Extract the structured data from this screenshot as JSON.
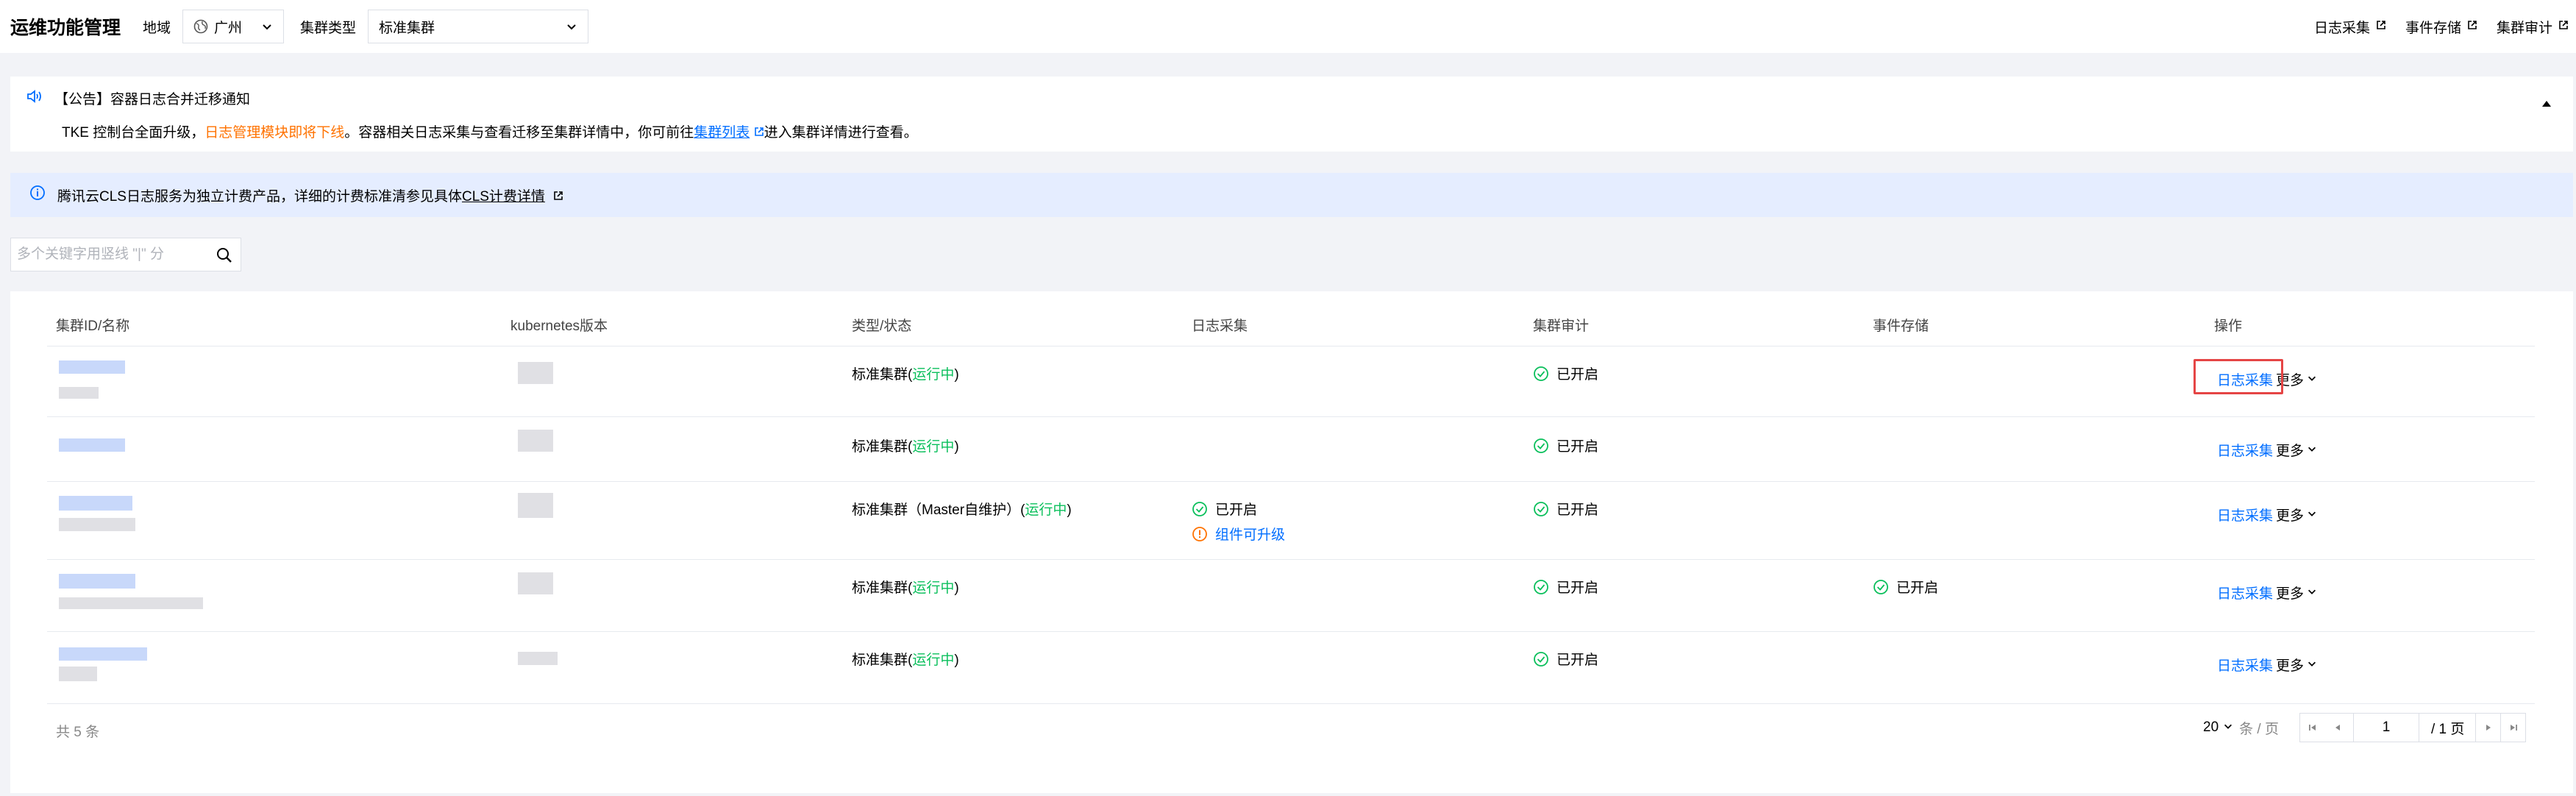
{
  "header": {
    "title": "运维功能管理",
    "region_label": "地域",
    "region_value": "广州",
    "cluster_type_label": "集群类型",
    "cluster_type_value": "标准集群",
    "links": [
      {
        "label": "日志采集",
        "icon": "external-link-icon"
      },
      {
        "label": "事件存储",
        "icon": "external-link-icon"
      },
      {
        "label": "集群审计",
        "icon": "external-link-icon"
      }
    ]
  },
  "notice": {
    "title": "【公告】容器日志合并迁移通知",
    "text_before": "TKE 控制台全面升级，",
    "text_highlight": "日志管理模块即将下线",
    "text_middle": "。容器相关日志采集与查看迁移至集群详情中，你可前往",
    "link_label": "集群列表",
    "text_after": "进入集群详情进行查看。",
    "highlight_color": "#ff7200"
  },
  "info_bar": {
    "text": "腾讯云CLS日志服务为独立计费产品，详细的计费标准清参见具体",
    "link_label": "CLS计费详情"
  },
  "search": {
    "placeholder": "多个关键字用竖线 \"|\" 分"
  },
  "table": {
    "columns": [
      "集群ID/名称",
      "kubernetes版本",
      "类型/状态",
      "日志采集",
      "集群审计",
      "事件存储",
      "操作"
    ],
    "rows": [
      {
        "type": "标准集群(",
        "status": "运行中",
        "type_tail": ")",
        "log": "",
        "log_sub": "",
        "audit": "已开启",
        "event": "",
        "op_log": "日志采集",
        "op_more": "更多"
      },
      {
        "type": "标准集群(",
        "status": "运行中",
        "type_tail": ")",
        "log": "",
        "log_sub": "",
        "audit": "已开启",
        "event": "",
        "op_log": "日志采集",
        "op_more": "更多"
      },
      {
        "type": "标准集群（Master自维护）(",
        "status": "运行中",
        "type_tail": ")",
        "log": "已开启",
        "log_sub": "组件可升级",
        "audit": "已开启",
        "event": "",
        "op_log": "日志采集",
        "op_more": "更多"
      },
      {
        "type": "标准集群(",
        "status": "运行中",
        "type_tail": ")",
        "log": "",
        "log_sub": "",
        "audit": "已开启",
        "event": "已开启",
        "op_log": "日志采集",
        "op_more": "更多"
      },
      {
        "type": "标准集群(",
        "status": "运行中",
        "type_tail": ")",
        "log": "",
        "log_sub": "",
        "audit": "已开启",
        "event": "",
        "op_log": "日志采集",
        "op_more": "更多"
      }
    ],
    "total": "共 5 条",
    "page_size": "20",
    "page_size_unit": "条 / 页",
    "current_page": "1",
    "total_pages": "/ 1 页"
  },
  "colors": {
    "accent": "#006eff",
    "success": "#0abf5b",
    "warning": "#ff7200",
    "highlight_box": "#e54545"
  }
}
